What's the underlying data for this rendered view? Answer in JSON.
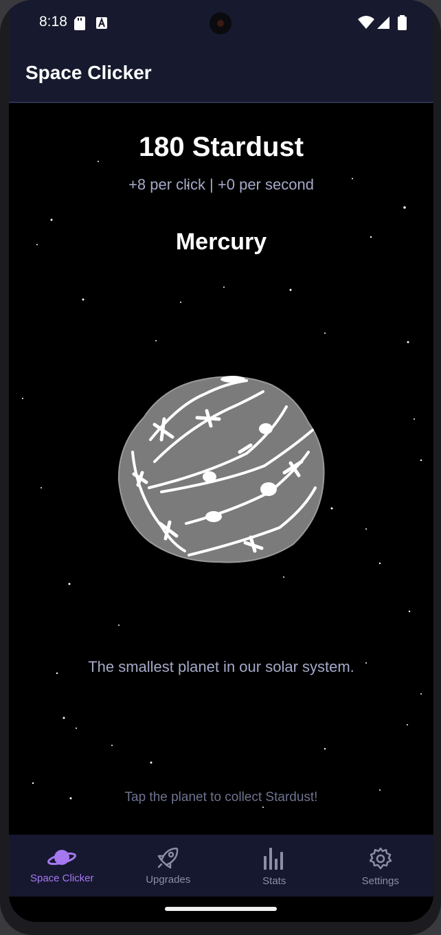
{
  "status_bar": {
    "time": "8:18"
  },
  "app_bar": {
    "title": "Space Clicker"
  },
  "game": {
    "stardust_text": "180 Stardust",
    "rates_text": "+8 per click | +0 per second",
    "planet_name": "Mercury",
    "planet_description": "The smallest planet in our solar system.",
    "tap_hint": "Tap the planet to collect Stardust!"
  },
  "nav": {
    "items": [
      {
        "label": "Space Clicker",
        "icon": "planet-icon",
        "active": true
      },
      {
        "label": "Upgrades",
        "icon": "rocket-icon",
        "active": false
      },
      {
        "label": "Stats",
        "icon": "bar-chart-icon",
        "active": false
      },
      {
        "label": "Settings",
        "icon": "gear-icon",
        "active": false
      }
    ]
  },
  "colors": {
    "accent": "#a678f0",
    "top_bar": "#171a2e",
    "nav_bar": "#161830",
    "secondary_text": "#a6a9c8",
    "planet_fill": "#7b7b7b"
  }
}
